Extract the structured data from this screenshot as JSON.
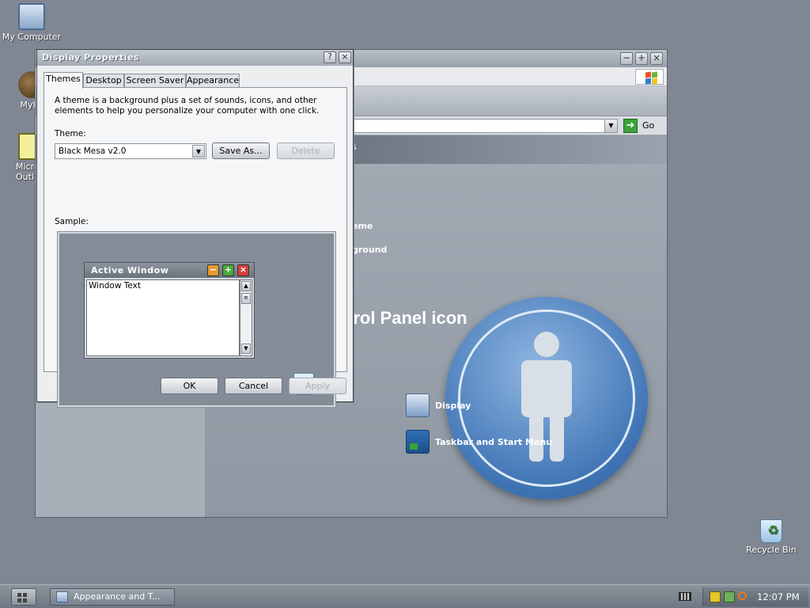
{
  "desktop": {
    "icons": [
      {
        "label": "My Computer",
        "icon": "computer-icon"
      },
      {
        "label": "MyPa",
        "icon": "paint-icon"
      },
      {
        "label": "Micro Outlo",
        "icon": "outlook-icon"
      },
      {
        "label": "Recycle Bin",
        "icon": "recycle-bin-icon"
      }
    ]
  },
  "control_panel": {
    "go_label": "Go",
    "header_suffix": "s",
    "links": [
      "",
      "eme",
      "ground"
    ],
    "title_partial": "trol Panel icon",
    "tasks": [
      "Display",
      "Taskbar and Start Menu"
    ]
  },
  "dialog": {
    "title": "Display Properties",
    "tabs": [
      "Themes",
      "Desktop",
      "Screen Saver",
      "Appearance"
    ],
    "active_tab": "Themes",
    "description": "A theme is a background plus a set of sounds, icons, and other elements to help you personalize your computer with one click.",
    "theme_label": "Theme:",
    "theme_value": "Black Mesa v2.0",
    "save_as": "Save As...",
    "delete": "Delete",
    "sample_label": "Sample:",
    "sample": {
      "window_title": "Active Window",
      "window_text": "Window Text"
    },
    "ok": "OK",
    "cancel": "Cancel",
    "apply": "Apply"
  },
  "taskbar": {
    "task_item": "Appearance and T...",
    "clock": "12:07 PM"
  },
  "colors": {
    "desktop": "#7f8792",
    "user_icon": "#3f74b4",
    "go_button": "#3aa23a"
  }
}
